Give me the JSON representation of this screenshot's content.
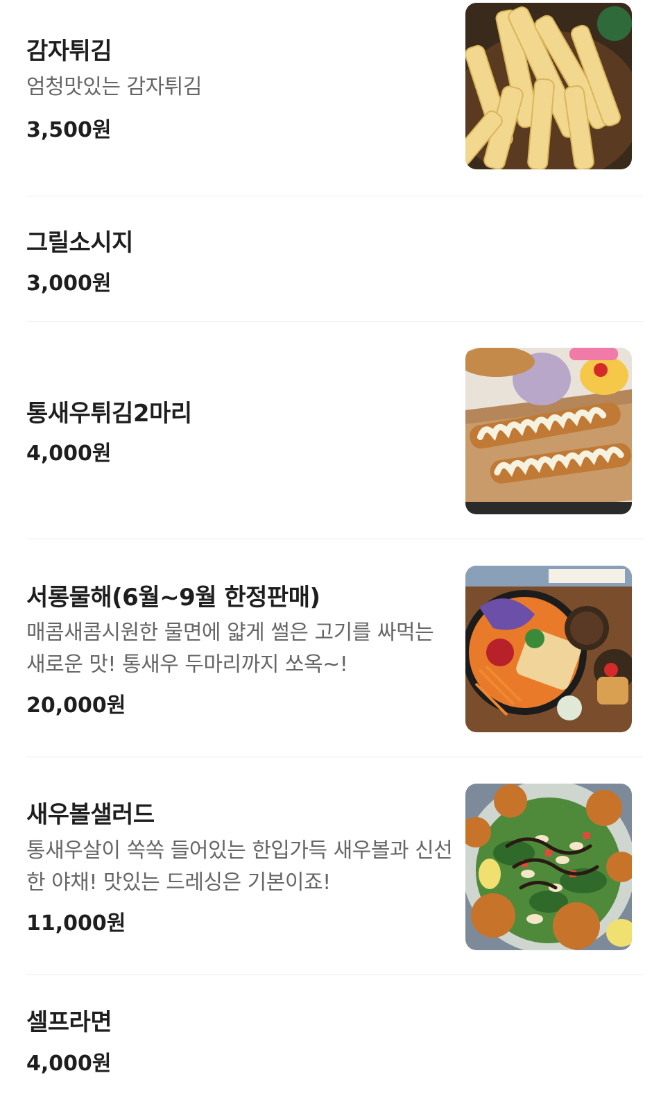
{
  "menu": {
    "items": [
      {
        "name": "감자튀김",
        "desc": "엄청맛있는 감자튀김",
        "price": "3,500원",
        "image": "french-fries-photo"
      },
      {
        "name": "그릴소시지",
        "price": "3,000원"
      },
      {
        "name": "통새우튀김2마리",
        "price": "4,000원",
        "image": "fried-shrimp-photo"
      },
      {
        "name": "서롱물해(6월~9월 한정판매)",
        "desc": "매콤새콤시원한 물면에 얇게 썰은 고기를 싸먹는 새로운 맛! 통새우 두마리까지 쏘옥~!",
        "price": "20,000원",
        "image": "cold-noodle-set-photo"
      },
      {
        "name": "새우볼샐러드",
        "desc": "통새우살이 쏙쏙 들어있는 한입가득 새우볼과 신선한 야채! 맛있는 드레싱은 기본이죠!",
        "price": "11,000원",
        "image": "shrimp-ball-salad-photo"
      },
      {
        "name": "셀프라면",
        "price": "4,000원"
      }
    ]
  }
}
